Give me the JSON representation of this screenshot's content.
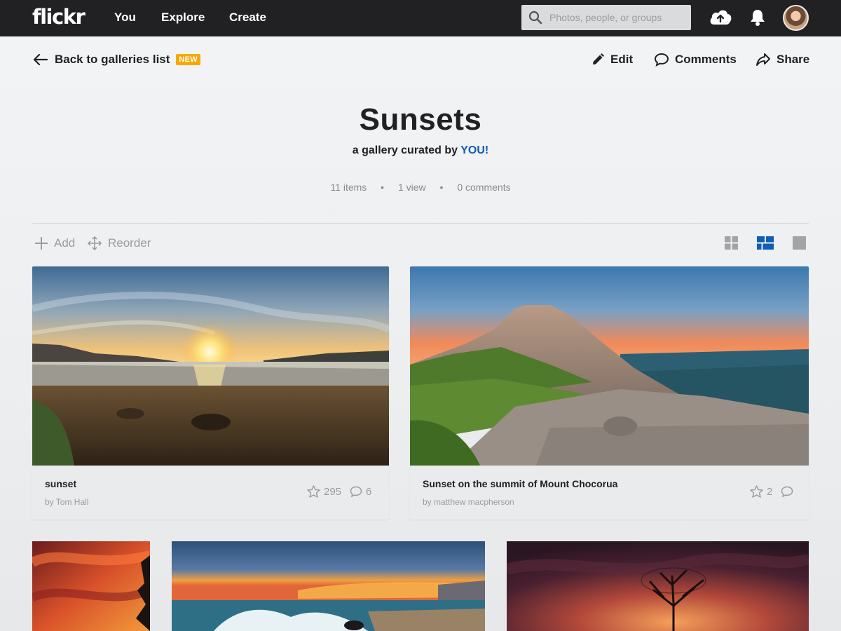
{
  "nav": {
    "logo": "flickr",
    "links": [
      "You",
      "Explore",
      "Create"
    ],
    "search_placeholder": "Photos, people, or groups",
    "icons": [
      "upload-cloud-icon",
      "notification-bell-icon",
      "user-avatar"
    ]
  },
  "toolbar": {
    "back_label": "Back to galleries list",
    "new_badge": "NEW",
    "edit_label": "Edit",
    "comments_label": "Comments",
    "share_label": "Share"
  },
  "gallery": {
    "title": "Sunsets",
    "subtitle_prefix": "a gallery curated by",
    "curator": "YOU!",
    "items": "11 items",
    "views": "1 view",
    "comments": "0 comments",
    "separator": "•"
  },
  "tools": {
    "add_label": "Add",
    "reorder_label": "Reorder",
    "view_modes": [
      "small-grid",
      "justified",
      "single"
    ],
    "active_view": "justified",
    "accent": "#0f5db5"
  },
  "photos": [
    {
      "title": "sunset",
      "author": "by Tom Hall",
      "faves": "295",
      "comments": "6"
    },
    {
      "title": "Sunset on the summit of Mount Chocorua",
      "author": "by matthew macpherson",
      "faves": "2",
      "comments": ""
    }
  ],
  "colors": {
    "topbar": "#212124",
    "badge": "#f7a800",
    "link": "#0f5db5"
  }
}
